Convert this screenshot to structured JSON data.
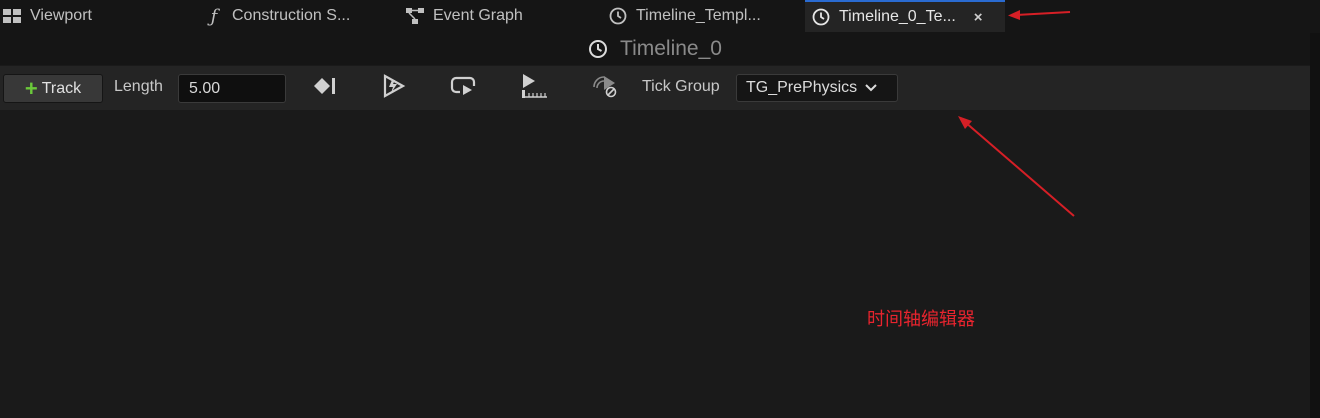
{
  "tabs": [
    {
      "label": "Viewport",
      "icon": "viewport-icon"
    },
    {
      "label": "Construction S...",
      "icon": "function-icon"
    },
    {
      "label": "Event Graph",
      "icon": "graph-icon"
    },
    {
      "label": "Timeline_Templ...",
      "icon": "clock-icon"
    },
    {
      "label": "Timeline_0_Te...",
      "icon": "clock-icon",
      "active": true,
      "close": "×"
    }
  ],
  "title": {
    "text": "Timeline_0",
    "icon": "clock-icon"
  },
  "toolbar": {
    "add_track_label": "Track",
    "length_label": "Length",
    "length_value": "5.00",
    "tick_group_label": "Tick Group",
    "tick_group_value": "TG_PrePhysics",
    "tools": [
      "add-key-icon",
      "autoplay-icon",
      "loop-icon",
      "use-last-keyframe-icon",
      "replicated-icon"
    ]
  },
  "annotation": {
    "text": "时间轴编辑器",
    "color": "#e8242e"
  },
  "colors": {
    "accent": "#2a6bd1",
    "add": "#6bc93a",
    "annotation": "#e8242e"
  }
}
